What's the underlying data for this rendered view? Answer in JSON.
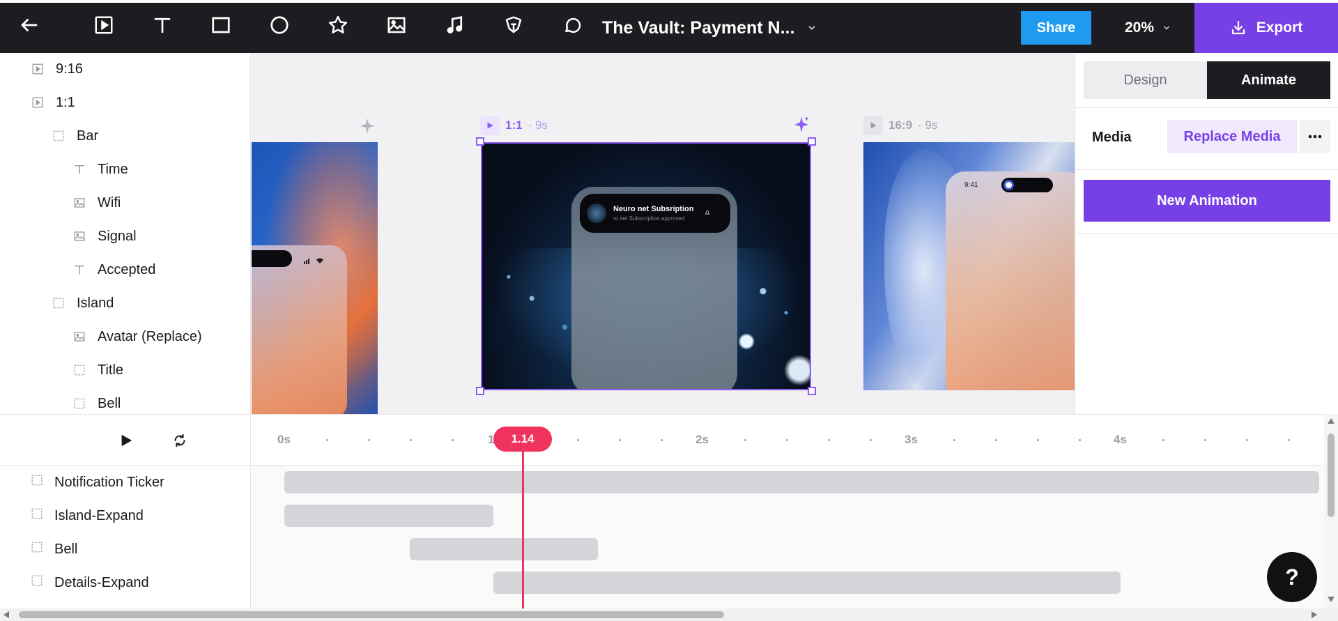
{
  "toolbar": {
    "doc_title": "The Vault: Payment N...",
    "share_label": "Share",
    "zoom_label": "20%",
    "export_label": "Export",
    "icons": [
      "back-arrow-icon",
      "video-icon",
      "text-icon",
      "rectangle-icon",
      "ellipse-icon",
      "star-icon",
      "image-icon",
      "music-icon",
      "pen-icon",
      "speech-bubble-icon"
    ]
  },
  "layers": [
    {
      "label": "9:16",
      "icon": "video-icon"
    },
    {
      "label": "1:1",
      "icon": "video-icon"
    },
    {
      "label": "Bar",
      "icon": "group-icon"
    },
    {
      "label": "Time",
      "icon": "text-icon"
    },
    {
      "label": "Wifi",
      "icon": "image-icon"
    },
    {
      "label": "Signal",
      "icon": "image-icon"
    },
    {
      "label": "Accepted",
      "icon": "text-icon"
    },
    {
      "label": "Island",
      "icon": "group-icon"
    },
    {
      "label": "Avatar (Replace)",
      "icon": "image-icon"
    },
    {
      "label": "Title",
      "icon": "group-icon"
    },
    {
      "label": "Bell",
      "icon": "group-icon"
    }
  ],
  "canvas": {
    "frame_center": {
      "ratio": "1:1",
      "duration": "· 9s",
      "notif_title": "Neuro net Subsription",
      "notif_sub": "ro net Subscription approved"
    },
    "frame_right": {
      "ratio": "16:9",
      "duration": "· 9s",
      "time": "9:41"
    }
  },
  "props": {
    "tab_design": "Design",
    "tab_animate": "Animate",
    "active_tab": "Animate",
    "media_label": "Media",
    "replace_media_label": "Replace Media",
    "new_animation_label": "New Animation"
  },
  "timeline": {
    "ticks": [
      "0s",
      "1s",
      "2s",
      "3s",
      "4s"
    ],
    "playhead": "1.14",
    "tracks": [
      {
        "label": "Notification Ticker",
        "start": 0.0,
        "end": 4.95
      },
      {
        "label": "Island-Expand",
        "start": 0.0,
        "end": 1.0
      },
      {
        "label": "Bell",
        "start": 0.6,
        "end": 1.5
      },
      {
        "label": "Details-Expand",
        "start": 1.0,
        "end": 4.0
      }
    ]
  },
  "help_label": "?"
}
